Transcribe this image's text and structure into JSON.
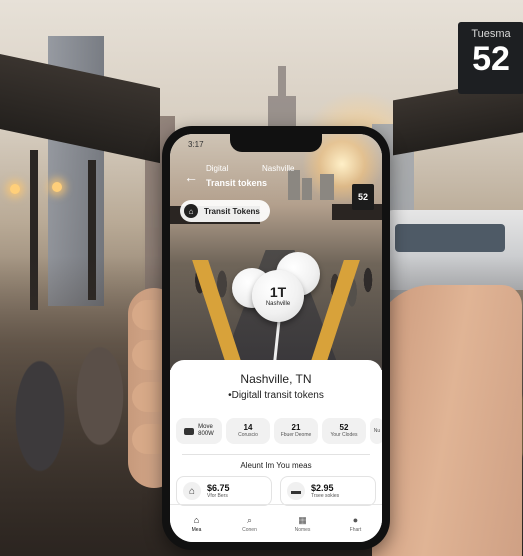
{
  "colors": {
    "accent": "#111111",
    "lane": "#d8a23a",
    "card": "#ffffff"
  },
  "background_sign": {
    "label": "Tuesma",
    "number": "52"
  },
  "status_bar": {
    "time": "3:17"
  },
  "header": {
    "back_icon": "arrow-left-icon",
    "line1": "Digital",
    "city": "Nashville",
    "line2": "Transit tokens",
    "route_sign": "52"
  },
  "pill": {
    "icon": "home-icon",
    "label": "Transit Tokens"
  },
  "token": {
    "number": "1T",
    "label": "Nashville"
  },
  "card": {
    "city": "Nashville, TN",
    "subtitle": "•Digitall transit tokens",
    "stats": [
      {
        "value": "Move",
        "label": "800W",
        "icon": "bus-icon"
      },
      {
        "value": "14",
        "label": "Coruscio"
      },
      {
        "value": "21",
        "label": "Fbuer Deome"
      },
      {
        "value": "52",
        "label": "Your Clodes"
      },
      {
        "value": "",
        "label": "Nu"
      }
    ],
    "section_title": "Aleunt Im You meas",
    "prices": [
      {
        "value": "$6.75",
        "label": "Vfor Bers",
        "icon": "home-icon"
      },
      {
        "value": "$2.95",
        "label": "Trsee sokies",
        "icon": "bus-icon"
      }
    ]
  },
  "tabs": [
    {
      "label": "Mea",
      "icon": "home-icon",
      "active": true
    },
    {
      "label": "Conen",
      "icon": "search-icon",
      "active": false
    },
    {
      "label": "Nomes",
      "icon": "grid-icon",
      "active": false
    },
    {
      "label": "Fhart",
      "icon": "person-icon",
      "active": false
    }
  ]
}
